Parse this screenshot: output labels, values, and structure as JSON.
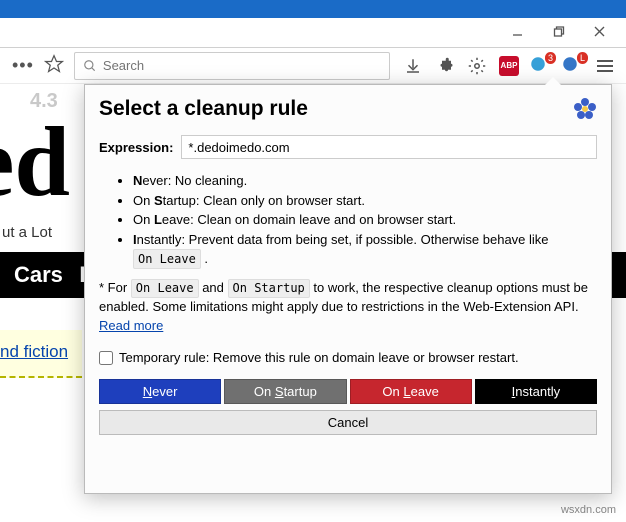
{
  "window": {
    "watermark": "wsxdn.com"
  },
  "toolbar": {
    "search_placeholder": "Search",
    "abp": "ABP",
    "badge1": "3",
    "badgeL": "L"
  },
  "page_bg": {
    "version": "4.3",
    "big": "ed",
    "sub": "ut a Lot",
    "nav1": "Cars",
    "nav2": "P",
    "link": "nd fiction"
  },
  "popup": {
    "title": "Select a cleanup rule",
    "expr_label": "Expression:",
    "expr_value": "*.dedoimedo.com",
    "rules": {
      "never": {
        "name": "Never",
        "desc": ": No cleaning."
      },
      "startup": {
        "name": "Startup",
        "prefix": "On ",
        "desc": ": Clean only on browser start."
      },
      "leave": {
        "name": "Leave",
        "prefix": "On ",
        "desc": ": Clean on domain leave and on browser start."
      },
      "instantly": {
        "name": "Instantly",
        "desc": ": Prevent data from being set, if possible. Otherwise behave like "
      },
      "instantly_code": "On Leave"
    },
    "footnote": {
      "star": "* For ",
      "code1": "On Leave",
      "and": " and ",
      "code2": "On Startup",
      "rest": " to work, the respective cleanup options must be enabled. Some limitations might apply due to restrictions in the Web-Extension API. ",
      "link": "Read more"
    },
    "temp_rule": "Temporary rule: Remove this rule on domain leave or browser restart.",
    "buttons": {
      "never": "Never",
      "never_u": "N",
      "startup": "On Startup",
      "startup_u": "S",
      "leave": "On Leave",
      "leave_u": "L",
      "instantly": "Instantly",
      "instantly_u": "I",
      "cancel": "Cancel"
    }
  }
}
